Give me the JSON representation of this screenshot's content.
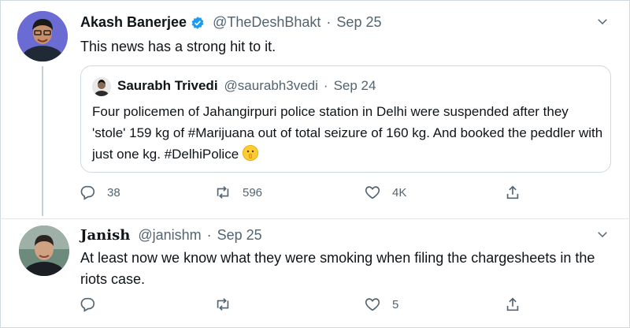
{
  "tweet1": {
    "name": "Akash Banerjee",
    "handle": "@TheDeshBhakt",
    "separator": "·",
    "date": "Sep 25",
    "text": "This news has a strong hit to it.",
    "quote": {
      "name": "Saurabh Trivedi",
      "handle": "@saurabh3vedi",
      "separator": "·",
      "date": "Sep 24",
      "text": "Four policemen of Jahangirpuri police station in Delhi were suspended after they 'stole' 159 kg of #Marijuana out of total seizure of 160 kg. And booked the peddler with just one kg. #DelhiPolice"
    },
    "replies": "38",
    "retweets": "596",
    "likes": "4K"
  },
  "tweet2": {
    "name": "𝐉𝐚𝐧𝐢𝐬𝐡",
    "handle": "@janishm",
    "separator": "·",
    "date": "Sep 25",
    "text": "At least now we know what they were smoking when filing the chargesheets in the riots case.",
    "replies": "",
    "retweets": "",
    "likes": "5"
  },
  "colors": {
    "verified": "#1d9bf0",
    "muted": "#536471",
    "border": "#cfd9de"
  },
  "icons": {
    "reply": "reply-icon",
    "retweet": "retweet-icon",
    "like": "like-icon",
    "share": "share-icon",
    "more": "chevron-down-icon",
    "verified": "verified-badge-icon",
    "emoji": "shushing-face-emoji"
  }
}
